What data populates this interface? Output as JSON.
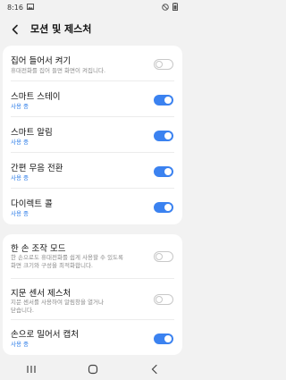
{
  "status_bar": {
    "time": "8:16"
  },
  "header": {
    "title": "모션 및 제스처"
  },
  "settings": [
    {
      "label": "집어 들어서 켜기",
      "sub": "휴대전화를 집어 들면 화면이 켜집니다.",
      "sub_style": "grey",
      "toggle": false
    },
    {
      "label": "스마트 스테이",
      "sub": "사용 중",
      "sub_style": "blue",
      "toggle": true
    },
    {
      "label": "스마트 알림",
      "sub": "사용 중",
      "sub_style": "blue",
      "toggle": true
    },
    {
      "label": "간편 무음 전환",
      "sub": "사용 중",
      "sub_style": "blue",
      "toggle": true
    },
    {
      "label": "다이렉트 콜",
      "sub": "사용 중",
      "sub_style": "blue",
      "toggle": true
    },
    {
      "label": "한 손 조작 모드",
      "sub_lines": [
        "한 손으로도 휴대전화를 쉽게 사용할 수 있도록",
        "화면 크기와 구성을 최적화합니다."
      ],
      "sub_style": "grey",
      "toggle": false
    },
    {
      "label": "지문 센서 제스처",
      "sub_lines": [
        "지문 센서를 사용하여 알림창을 열거나",
        "닫습니다."
      ],
      "sub_style": "grey",
      "toggle": false
    },
    {
      "label": "손으로 밀어서 캡처",
      "sub": "사용 중",
      "sub_style": "blue",
      "toggle": true
    }
  ],
  "colors": {
    "accent": "#3b82f0",
    "background": "#f2f2f2",
    "card": "#ffffff"
  }
}
